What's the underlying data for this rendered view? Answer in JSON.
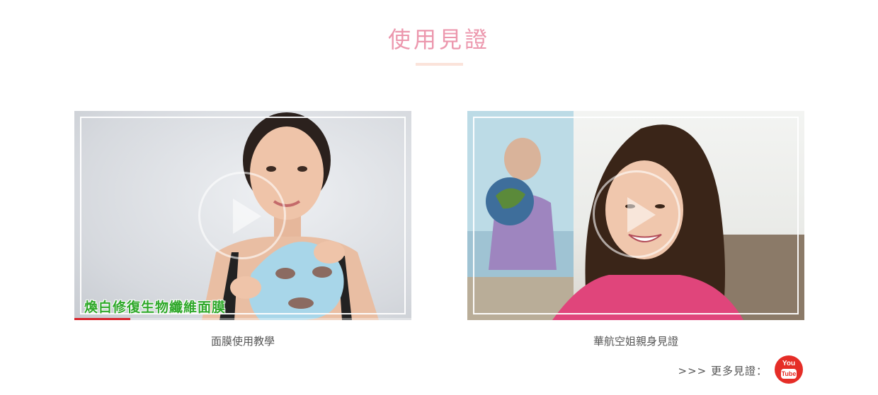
{
  "section": {
    "title": "使用見證"
  },
  "videos": [
    {
      "caption_overlay": "煥白修復生物纖維面膜",
      "label": "面膜使用教學",
      "progress_fraction": 0.165
    },
    {
      "caption_overlay": "",
      "label": "華航空姐親身見證"
    }
  ],
  "more": {
    "label": ">>> 更多見證："
  },
  "youtube": {
    "you": "You",
    "tube": "Tube"
  },
  "colors": {
    "title": "#ec97ad",
    "underline": "#fbe3da",
    "youtube_red": "#e52d27",
    "progress_red": "#d8232a",
    "caption_green": "#2fa82a"
  },
  "icons": {
    "play": "play-circle-icon",
    "youtube": "youtube-logo-icon"
  }
}
